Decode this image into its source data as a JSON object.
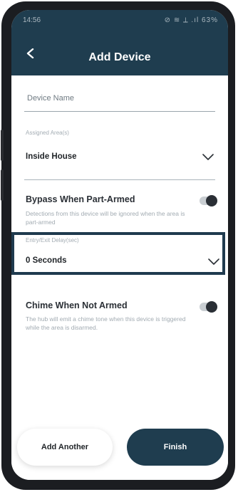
{
  "status_bar": {
    "time": "14:56",
    "indicators": "⊘ ≋ ⟂ .ıl 63%"
  },
  "header": {
    "title": "Add Device",
    "back_icon": "chevron-left-icon"
  },
  "device_name": {
    "placeholder": "Device Name"
  },
  "assigned_area": {
    "label": "Assigned Area(s)",
    "value": "Inside House"
  },
  "bypass": {
    "title": "Bypass When Part-Armed",
    "description_line1": "Detections from this device will be ignored when the area is",
    "description_line2": "part-armed",
    "enabled": false
  },
  "entry_exit_delay": {
    "label": "Entry/Exit Delay(sec)",
    "value": "0 Seconds"
  },
  "chime": {
    "title": "Chime When Not Armed",
    "description_line1": "The hub will emit a chime tone when this device is triggered",
    "description_line2": "while the area is disarmed.",
    "enabled": false
  },
  "footer": {
    "add_another_label": "Add Another",
    "finish_label": "Finish"
  },
  "colors": {
    "header_bg": "#1f3d4f",
    "highlight_border": "#1f3a4e"
  }
}
